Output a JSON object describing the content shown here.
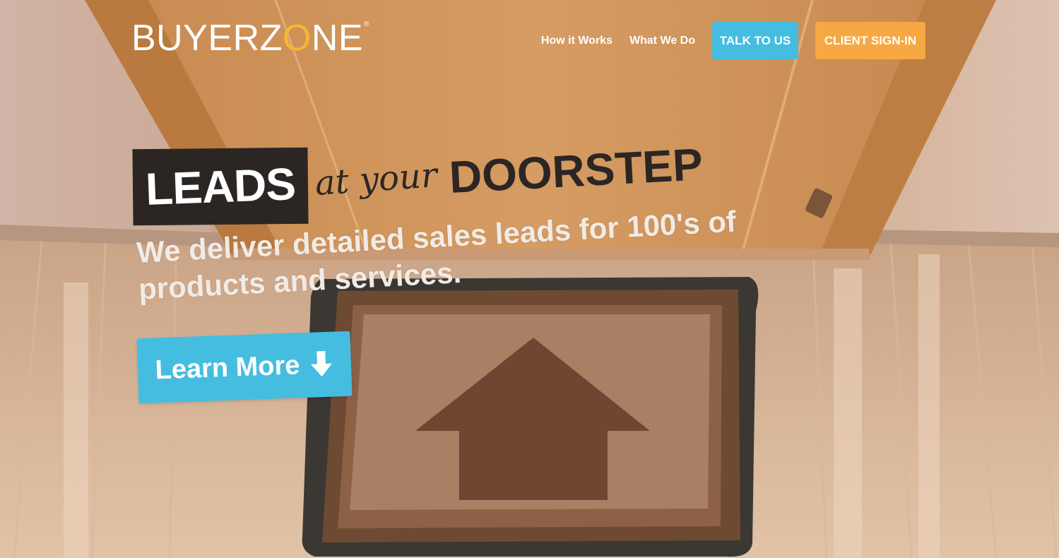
{
  "brand": {
    "logo_text_before": "BUYERZ",
    "logo_o": "O",
    "logo_text_after": "NE",
    "registered_mark": "®",
    "accent_color": "#f5b731"
  },
  "nav": {
    "links": [
      {
        "label": "How it Works"
      },
      {
        "label": "What We Do"
      }
    ],
    "talk_button": {
      "label": "TALK TO US",
      "color": "#45bde1"
    },
    "signin_button": {
      "label": "CLIENT SIGN-IN",
      "color": "#f6a843"
    }
  },
  "hero": {
    "headline_box": "LEADS",
    "headline_script": "at your",
    "headline_end": "DOORSTEP",
    "subheadline": "We deliver detailed sales leads for 100's of products and services.",
    "cta": {
      "label": "Learn More",
      "icon": "arrow-down-icon",
      "color": "#45bde1"
    }
  }
}
